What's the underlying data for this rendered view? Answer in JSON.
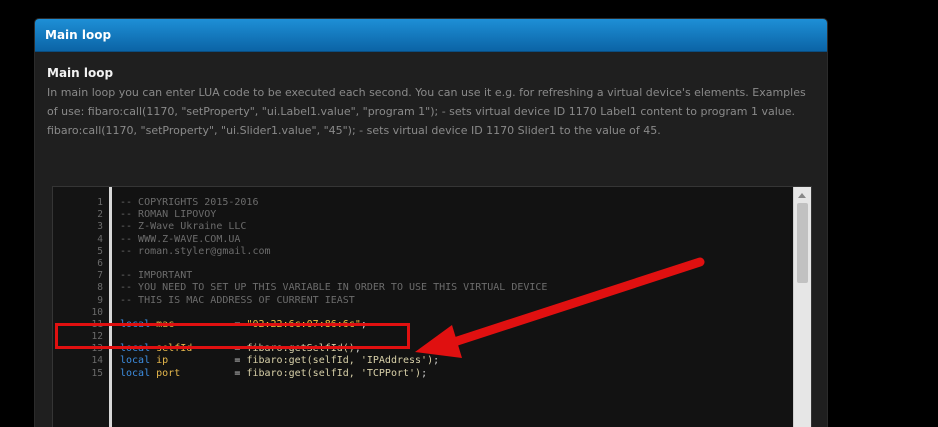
{
  "panel": {
    "header": "Main loop",
    "title": "Main loop",
    "description": "In main loop you can enter LUA code to be executed each second. You can use it e.g. for refreshing a virtual device's elements. Examples of use: fibaro:call(1170, \"setProperty\", \"ui.Label1.value\", \"program 1\"); - sets virtual device ID 1170 Label1 content to program 1 value. fibaro:call(1170, \"setProperty\", \"ui.Slider1.value\", \"45\"); - sets virtual device ID 1170 Slider1 to the value of 45."
  },
  "editor": {
    "lines": [
      {
        "n": "1",
        "comment": "-- COPYRIGHTS 2015-2016"
      },
      {
        "n": "2",
        "comment": "-- ROMAN LIPOVOY"
      },
      {
        "n": "3",
        "comment": "-- Z-Wave Ukraine LLC"
      },
      {
        "n": "4",
        "comment": "-- WWW.Z-WAVE.COM.UA"
      },
      {
        "n": "5",
        "comment": "-- roman.styler@gmail.com"
      },
      {
        "n": "6",
        "comment": ""
      },
      {
        "n": "7",
        "comment": "-- IMPORTANT"
      },
      {
        "n": "8",
        "comment": "-- YOU NEED TO SET UP THIS VARIABLE IN ORDER TO USE THIS VIRTUAL DEVICE"
      },
      {
        "n": "9",
        "comment": "-- THIS IS MAC ADDRESS OF CURRENT IEAST"
      },
      {
        "n": "10",
        "comment": ""
      },
      {
        "n": "11",
        "kw": "local",
        "var": " mac",
        "op": "          = ",
        "val": "\"02:22:6c:07:86:6c\"",
        "tail": ";"
      },
      {
        "n": "12",
        "comment": ""
      },
      {
        "n": "13",
        "kw": "local",
        "var": " selfId",
        "op": "       = ",
        "val": "fibaro:getSelfId()",
        "tail": ";"
      },
      {
        "n": "14",
        "kw": "local",
        "var": " ip",
        "op": "           = ",
        "val": "fibaro:get(selfId, 'IPAddress')",
        "tail": ";"
      },
      {
        "n": "15",
        "kw": "local",
        "var": " port",
        "op": "         = ",
        "val": "fibaro:get(selfId, 'TCPPort')",
        "tail": ";"
      }
    ]
  },
  "colors": {
    "header_blue": "#1a85cc",
    "highlight_red": "#e01010",
    "keyword_blue": "#3d8de0",
    "string_yellow": "#f4c544"
  },
  "icons": {
    "scroll_up": "chevron-up-icon",
    "annotation": "red-arrow-icon"
  }
}
